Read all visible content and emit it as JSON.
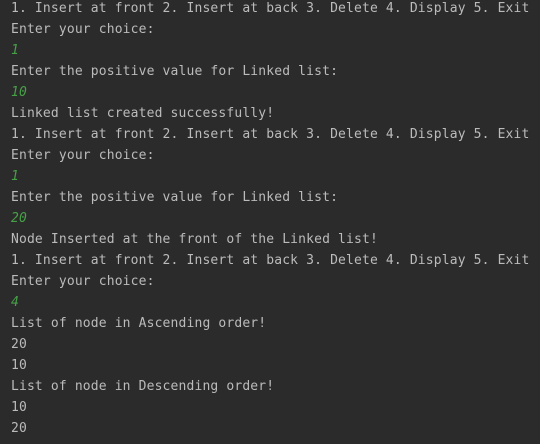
{
  "console": {
    "lines": [
      {
        "kind": "out",
        "text": "1. Insert at front 2. Insert at back 3. Delete 4. Display 5. Exit"
      },
      {
        "kind": "out",
        "text": "Enter your choice:"
      },
      {
        "kind": "in",
        "text": "1"
      },
      {
        "kind": "out",
        "text": "Enter the positive value for Linked list:"
      },
      {
        "kind": "in",
        "text": "10"
      },
      {
        "kind": "out",
        "text": "Linked list created successfully!"
      },
      {
        "kind": "out",
        "text": "1. Insert at front 2. Insert at back 3. Delete 4. Display 5. Exit"
      },
      {
        "kind": "out",
        "text": "Enter your choice:"
      },
      {
        "kind": "in",
        "text": "1"
      },
      {
        "kind": "out",
        "text": "Enter the positive value for Linked list:"
      },
      {
        "kind": "in",
        "text": "20"
      },
      {
        "kind": "out",
        "text": "Node Inserted at the front of the Linked list!"
      },
      {
        "kind": "out",
        "text": "1. Insert at front 2. Insert at back 3. Delete 4. Display 5. Exit"
      },
      {
        "kind": "out",
        "text": "Enter your choice:"
      },
      {
        "kind": "in",
        "text": "4"
      },
      {
        "kind": "out",
        "text": "List of node in Ascending order!"
      },
      {
        "kind": "out",
        "text": "20"
      },
      {
        "kind": "out",
        "text": "10"
      },
      {
        "kind": "out",
        "text": "List of node in Descending order!"
      },
      {
        "kind": "out",
        "text": "10"
      },
      {
        "kind": "out",
        "text": "20"
      }
    ]
  },
  "colors": {
    "background": "#2b2b2b",
    "output_text": "#bbbbbb",
    "user_input_text": "#47a047"
  }
}
